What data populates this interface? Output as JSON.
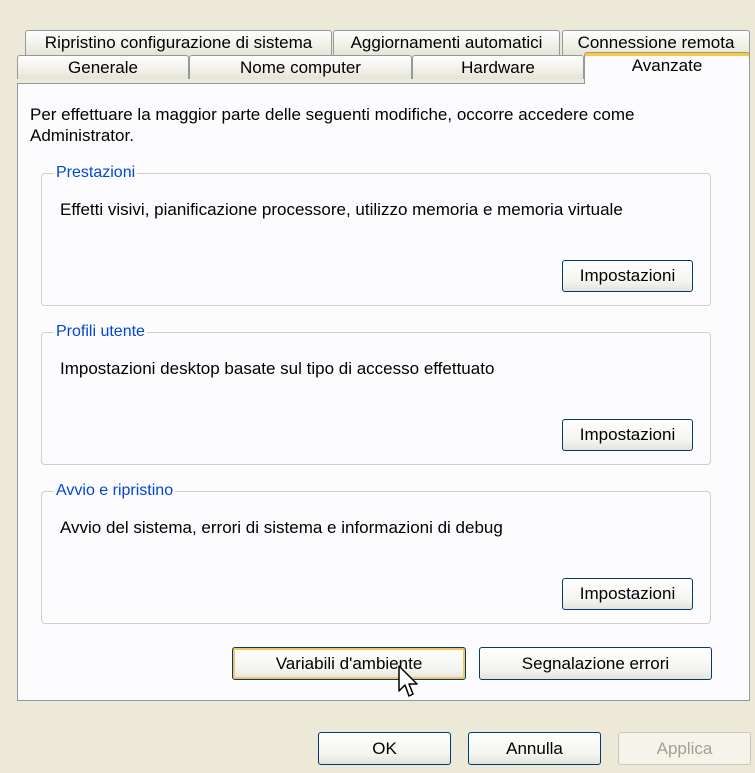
{
  "tabs": {
    "row1": [
      {
        "label": "Ripristino configurazione di sistema"
      },
      {
        "label": "Aggiornamenti automatici"
      },
      {
        "label": "Connessione remota"
      }
    ],
    "row2": [
      {
        "label": "Generale"
      },
      {
        "label": "Nome computer"
      },
      {
        "label": "Hardware"
      },
      {
        "label": "Avanzate",
        "selected": true
      }
    ]
  },
  "intro_text": "Per effettuare la maggior parte delle seguenti modifiche, occorre accedere come Administrator.",
  "groups": [
    {
      "title": "Prestazioni",
      "description": "Effetti visivi, pianificazione processore, utilizzo memoria e memoria virtuale",
      "button": "Impostazioni"
    },
    {
      "title": "Profili utente",
      "description": "Impostazioni desktop basate sul tipo di accesso effettuato",
      "button": "Impostazioni"
    },
    {
      "title": "Avvio e ripristino",
      "description": "Avvio del sistema, errori di sistema e informazioni di debug",
      "button": "Impostazioni"
    }
  ],
  "buttons": {
    "env_vars": "Variabili d'ambiente",
    "error_reporting": "Segnalazione errori",
    "ok": "OK",
    "cancel": "Annulla",
    "apply": "Applica"
  },
  "colors": {
    "group_title": "#0046d5",
    "active_tab_highlight": "#ffc83c",
    "dialog_bg": "#ece9d8"
  },
  "icons": {
    "cursor": "mouse-pointer-icon"
  }
}
